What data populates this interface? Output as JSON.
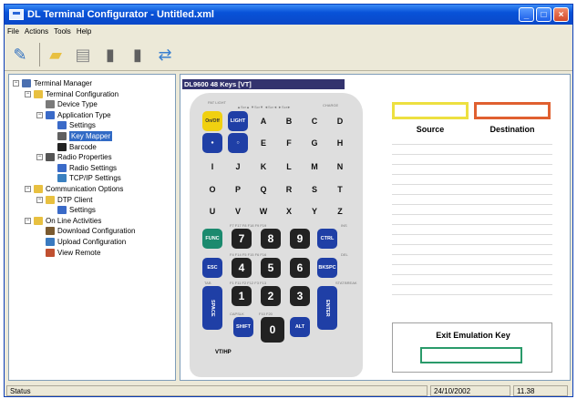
{
  "window": {
    "title": "DL Terminal Configurator - Untitled.xml"
  },
  "menu": [
    "File",
    "Actions",
    "Tools",
    "Help"
  ],
  "toolbar": {
    "icons": [
      "edit-document-icon",
      "open-folder-icon",
      "print-icon",
      "upload-terminal-icon",
      "download-terminal-icon",
      "connect-icon"
    ]
  },
  "tree": [
    {
      "label": "Terminal Manager",
      "level": 0,
      "toggle": "−",
      "icon": "computer"
    },
    {
      "label": "Terminal Configuration",
      "level": 1,
      "toggle": "−",
      "icon": "folder"
    },
    {
      "label": "Device Type",
      "level": 2,
      "toggle": "",
      "icon": "device"
    },
    {
      "label": "Application Type",
      "level": 2,
      "toggle": "−",
      "icon": "app"
    },
    {
      "label": "Settings",
      "level": 3,
      "toggle": "",
      "icon": "settings"
    },
    {
      "label": "Key Mapper",
      "level": 3,
      "toggle": "",
      "icon": "key",
      "selected": true
    },
    {
      "label": "Barcode",
      "level": 3,
      "toggle": "",
      "icon": "barcode"
    },
    {
      "label": "Radio Properties",
      "level": 2,
      "toggle": "−",
      "icon": "radio"
    },
    {
      "label": "Radio Settings",
      "level": 3,
      "toggle": "",
      "icon": "settings"
    },
    {
      "label": "TCP/IP Settings",
      "level": 3,
      "toggle": "",
      "icon": "network"
    },
    {
      "label": "Communication Options",
      "level": 1,
      "toggle": "−",
      "icon": "folder"
    },
    {
      "label": "DTP Client",
      "level": 2,
      "toggle": "−",
      "icon": "folder"
    },
    {
      "label": "Settings",
      "level": 3,
      "toggle": "",
      "icon": "settings"
    },
    {
      "label": "On Line Activities",
      "level": 1,
      "toggle": "−",
      "icon": "folder"
    },
    {
      "label": "Download Configuration",
      "level": 2,
      "toggle": "",
      "icon": "download"
    },
    {
      "label": "Upload Configuration",
      "level": 2,
      "toggle": "",
      "icon": "upload"
    },
    {
      "label": "View Remote",
      "level": 2,
      "toggle": "",
      "icon": "remote"
    }
  ],
  "keypad": {
    "title": "DL9600 48 Keys [VT]",
    "model": "VT/HP",
    "rows": [
      [
        {
          "t": "On/Off",
          "c": "yl"
        },
        {
          "t": "LIGHT",
          "c": "bl"
        },
        {
          "t": "A"
        },
        {
          "t": "B"
        },
        {
          "t": "C"
        },
        {
          "t": "D"
        }
      ],
      [
        {
          "t": "●",
          "c": "bl"
        },
        {
          "t": "○",
          "c": "bl"
        },
        {
          "t": "E"
        },
        {
          "t": "F"
        },
        {
          "t": "G"
        },
        {
          "t": "H"
        }
      ],
      [
        {
          "t": "I"
        },
        {
          "t": "J"
        },
        {
          "t": "K"
        },
        {
          "t": "L"
        },
        {
          "t": "M"
        },
        {
          "t": "N"
        }
      ],
      [
        {
          "t": "O"
        },
        {
          "t": "P"
        },
        {
          "t": "Q"
        },
        {
          "t": "R"
        },
        {
          "t": "S"
        },
        {
          "t": "T"
        }
      ],
      [
        {
          "t": "U"
        },
        {
          "t": "V"
        },
        {
          "t": "W"
        },
        {
          "t": "X"
        },
        {
          "t": "Y"
        },
        {
          "t": "Z"
        }
      ],
      [
        {
          "t": "FUNC",
          "c": "gr"
        },
        {
          "t": "7",
          "c": "bk"
        },
        {
          "t": "8",
          "c": "bk"
        },
        {
          "t": "9",
          "c": "bk"
        },
        {
          "t": "CTRL",
          "c": "bl"
        }
      ],
      [
        {
          "t": "ESC",
          "c": "bl"
        },
        {
          "t": "4",
          "c": "bk"
        },
        {
          "t": "5",
          "c": "bk"
        },
        {
          "t": "6",
          "c": "bk"
        },
        {
          "t": "BKSPC",
          "c": "bl"
        }
      ],
      [
        {
          "t": "SPACE",
          "c": "bl",
          "tall": true
        },
        {
          "t": "1",
          "c": "bk"
        },
        {
          "t": "2",
          "c": "bk"
        },
        {
          "t": "3",
          "c": "bk"
        },
        {
          "t": "ENTER",
          "c": "bl",
          "tall": true
        }
      ],
      [
        {
          "t": "SHIFT",
          "c": "bl"
        },
        {
          "t": "0",
          "c": "bk"
        },
        {
          "t": "ALT",
          "c": "bl"
        }
      ]
    ],
    "labels": [
      "PAT LIGHT",
      "▲Scr▲ ▼Scr▼ ◄Scr◄ ►Scr►",
      "CHARGE",
      "F7 F17 F8 F18 F9 F19",
      "INS",
      "F4 F14 F5 F15 F6 F16",
      "DEL",
      "TAB",
      "F1 F11 F2 F12 F3 F13",
      "STAT",
      "BREAK",
      "CAPSLK",
      "F10 F20"
    ]
  },
  "mapper": {
    "source_label": "Source",
    "destination_label": "Destination"
  },
  "exit": {
    "label": "Exit Emulation Key"
  },
  "status": {
    "text": "Status",
    "date": "24/10/2002",
    "time": "11.38"
  }
}
